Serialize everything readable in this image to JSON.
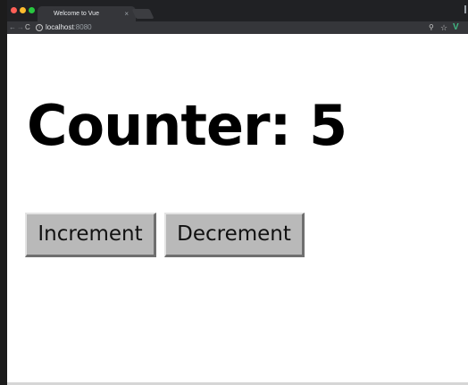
{
  "browser": {
    "tab_title": "Welcome to Vue",
    "tab_close": "×",
    "url_host": "localhost",
    "url_port": ":8080",
    "icons": {
      "back": "arrow-left",
      "forward": "arrow-right",
      "reload": "reload",
      "info": "info",
      "zoom": "magnifier",
      "bookmark": "star",
      "extension": "vue-devtools"
    },
    "colors": {
      "close": "#ff5f57",
      "minimize": "#febc2e",
      "maximize": "#28c840",
      "vue": "#41b883"
    }
  },
  "page": {
    "heading": "Counter: 5",
    "increment_label": "Increment",
    "decrement_label": "Decrement"
  }
}
